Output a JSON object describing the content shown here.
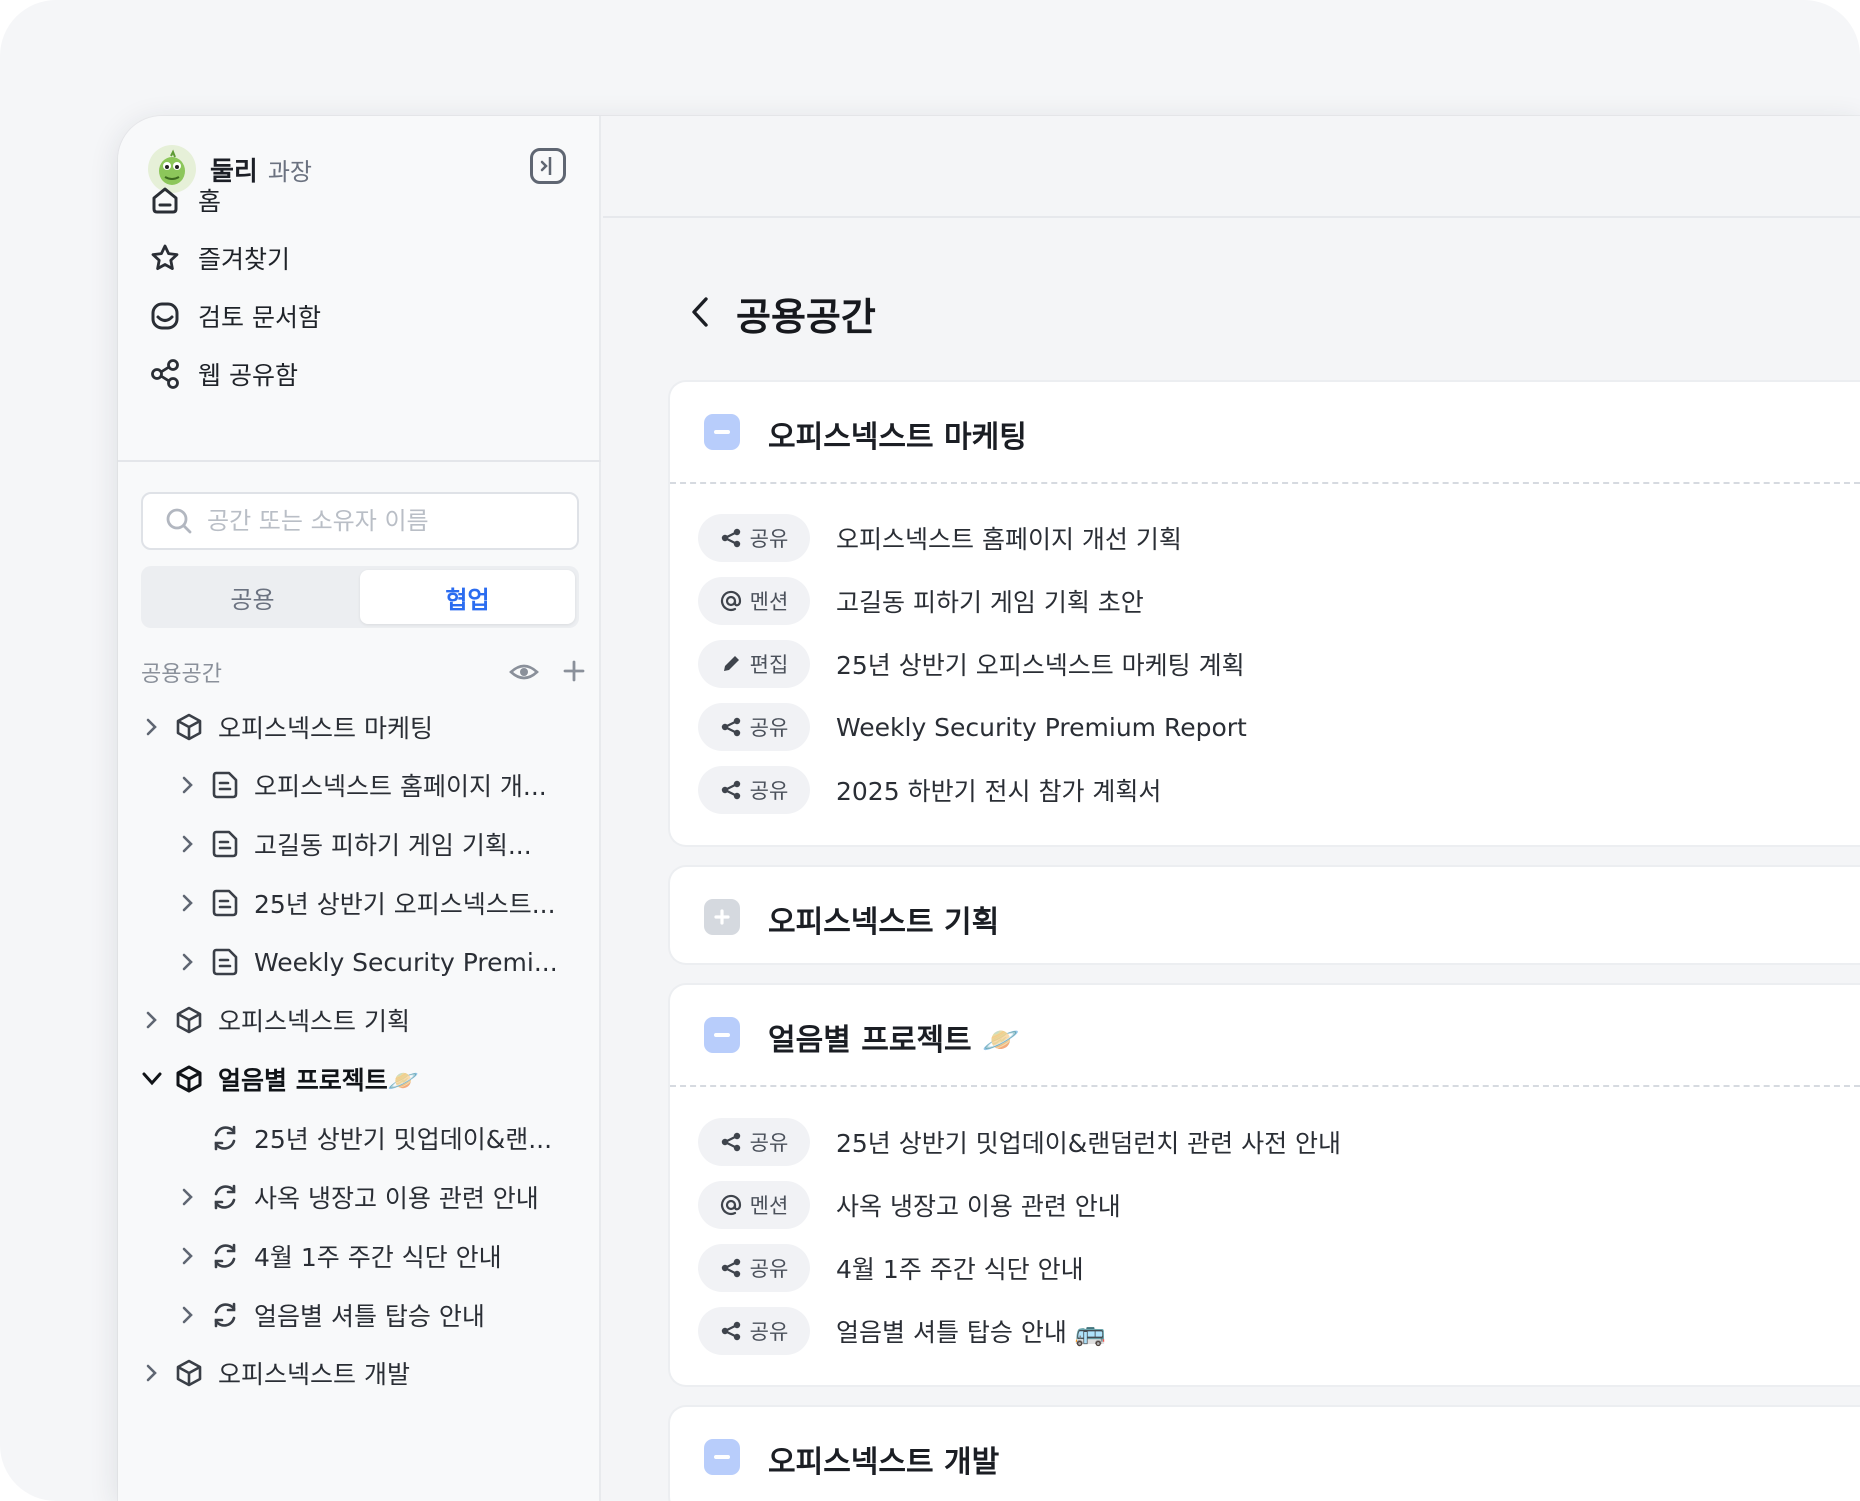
{
  "profile": {
    "name": "둘리",
    "role": "과장"
  },
  "nav": [
    {
      "label": "홈",
      "icon": "home-icon"
    },
    {
      "label": "즐겨찾기",
      "icon": "star-icon"
    },
    {
      "label": "검토 문서함",
      "icon": "inbox-icon"
    },
    {
      "label": "웹 공유함",
      "icon": "share-icon"
    }
  ],
  "search": {
    "placeholder": "공간 또는 소유자 이름"
  },
  "segments": {
    "left": "공용",
    "right": "협업",
    "active": "협업"
  },
  "space_section": {
    "title": "공용공간"
  },
  "tree": [
    {
      "label": "오피스넥스트 마케팅",
      "type": "space",
      "expanded": false
    },
    {
      "label": "오피스넥스트 홈페이지 개...",
      "type": "doc"
    },
    {
      "label": "고길동 피하기 게임 기획...",
      "type": "doc"
    },
    {
      "label": "25년 상반기 오피스넥스트...",
      "type": "doc"
    },
    {
      "label": "Weekly Security Premi...",
      "type": "doc"
    },
    {
      "label": "오피스넥스트 기획",
      "type": "space",
      "expanded": false
    },
    {
      "label": "얼음별 프로젝트🪐",
      "type": "space",
      "expanded": true
    },
    {
      "label": "25년 상반기 밋업데이&랜...",
      "type": "sync"
    },
    {
      "label": "사옥 냉장고 이용 관련 안내",
      "type": "sync"
    },
    {
      "label": "4월 1주 주간 식단 안내",
      "type": "sync"
    },
    {
      "label": "얼음별 셔틀 탑승 안내",
      "type": "sync"
    },
    {
      "label": "오피스넥스트 개발",
      "type": "space",
      "expanded": false
    }
  ],
  "main": {
    "title": "공용공간",
    "cards": [
      {
        "title": "오피스넥스트 마케팅",
        "expanded": true,
        "rows": [
          {
            "tag": "공유",
            "tag_icon": "share-icon",
            "doc": "오피스넥스트 홈페이지 개선 기획"
          },
          {
            "tag": "멘션",
            "tag_icon": "at-icon",
            "doc": "고길동 피하기 게임 기획 초안"
          },
          {
            "tag": "편집",
            "tag_icon": "pencil-icon",
            "doc": "25년 상반기 오피스넥스트 마케팅 계획"
          },
          {
            "tag": "공유",
            "tag_icon": "share-icon",
            "doc": "Weekly Security Premium Report"
          },
          {
            "tag": "공유",
            "tag_icon": "share-icon",
            "doc": "2025 하반기 전시 참가 계획서"
          }
        ]
      },
      {
        "title": "오피스넥스트 기획",
        "expanded": false,
        "rows": []
      },
      {
        "title": "얼음별 프로젝트 🪐",
        "expanded": true,
        "rows": [
          {
            "tag": "공유",
            "tag_icon": "share-icon",
            "doc": "25년 상반기 밋업데이&랜덤런치 관련 사전 안내"
          },
          {
            "tag": "멘션",
            "tag_icon": "at-icon",
            "doc": "사옥 냉장고 이용 관련 안내"
          },
          {
            "tag": "공유",
            "tag_icon": "share-icon",
            "doc": "4월 1주 주간 식단 안내"
          },
          {
            "tag": "공유",
            "tag_icon": "share-icon",
            "doc": "얼음별 셔틀 탑승 안내 🚌"
          }
        ]
      },
      {
        "title": "오피스넥스트 개발",
        "expanded": true,
        "rows": []
      }
    ]
  },
  "colors": {
    "accent": "#2b6cf0",
    "toggle_active": "#b8cdfb",
    "toggle_inactive": "#d5d9df"
  }
}
